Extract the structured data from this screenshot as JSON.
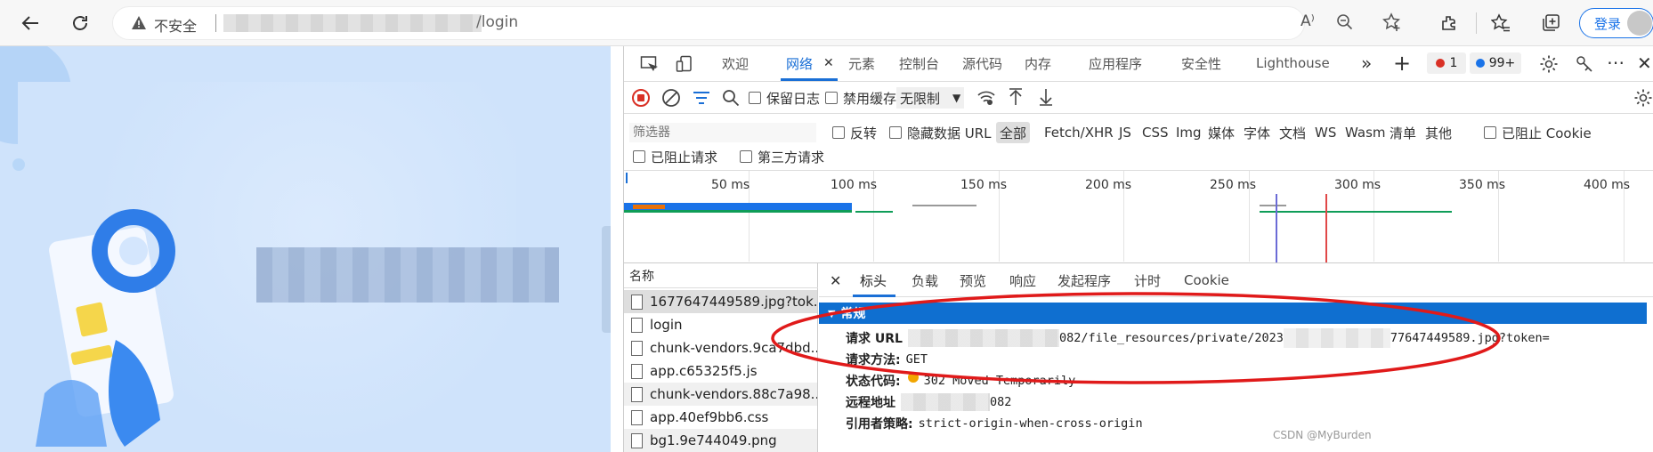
{
  "browser": {
    "security_label": "不安全",
    "url_suffix": "/login",
    "login_label": "登录"
  },
  "devtools": {
    "tabs": [
      "欢迎",
      "网络",
      "元素",
      "控制台",
      "源代码",
      "内存",
      "应用程序",
      "安全性",
      "Lighthouse"
    ],
    "more_tabs": "»",
    "add_tab": "+",
    "errors_count": "1",
    "issues_count": "99+",
    "toolbar": {
      "preserve_log": "保留日志",
      "disable_cache": "禁用缓存",
      "throttle": "无限制"
    },
    "filter": {
      "placeholder": "筛选器",
      "invert": "反转",
      "hide_data_url": "隐藏数据 URL",
      "types": [
        "全部",
        "Fetch/XHR",
        "JS",
        "CSS",
        "Img",
        "媒体",
        "字体",
        "文档",
        "WS",
        "Wasm",
        "清单",
        "其他"
      ],
      "blocked_cookie": "已阻止 Cookie",
      "blocked_requests": "已阻止请求",
      "third_party": "第三方请求"
    },
    "timeline_ticks": [
      "50 ms",
      "100 ms",
      "150 ms",
      "200 ms",
      "250 ms",
      "300 ms",
      "350 ms",
      "400 ms"
    ],
    "name_header": "名称",
    "files": [
      "1677647449589.jpg?tok...",
      "login",
      "chunk-vendors.9ca7dbd...",
      "app.c65325f5.js",
      "chunk-vendors.88c7a98...",
      "app.40ef9bb6.css",
      "bg1.9e744049.png"
    ],
    "detail_tabs": [
      "标头",
      "负载",
      "预览",
      "响应",
      "发起程序",
      "计时",
      "Cookie"
    ],
    "section_title": "常规",
    "general": {
      "url_label": "请求 URL",
      "url_value_a": "082/file_resources/private/2023",
      "url_value_b": "77647449589.jpg?token=",
      "method_label": "请求方法:",
      "method_value": "GET",
      "status_label": "状态代码:",
      "status_value": "302 Moved Temporarily",
      "remote_label": "远程地址",
      "remote_value": "082",
      "referrer_label": "引用者策略:",
      "referrer_value": "strict-origin-when-cross-origin"
    }
  },
  "watermark": "CSDN @MyBurden"
}
